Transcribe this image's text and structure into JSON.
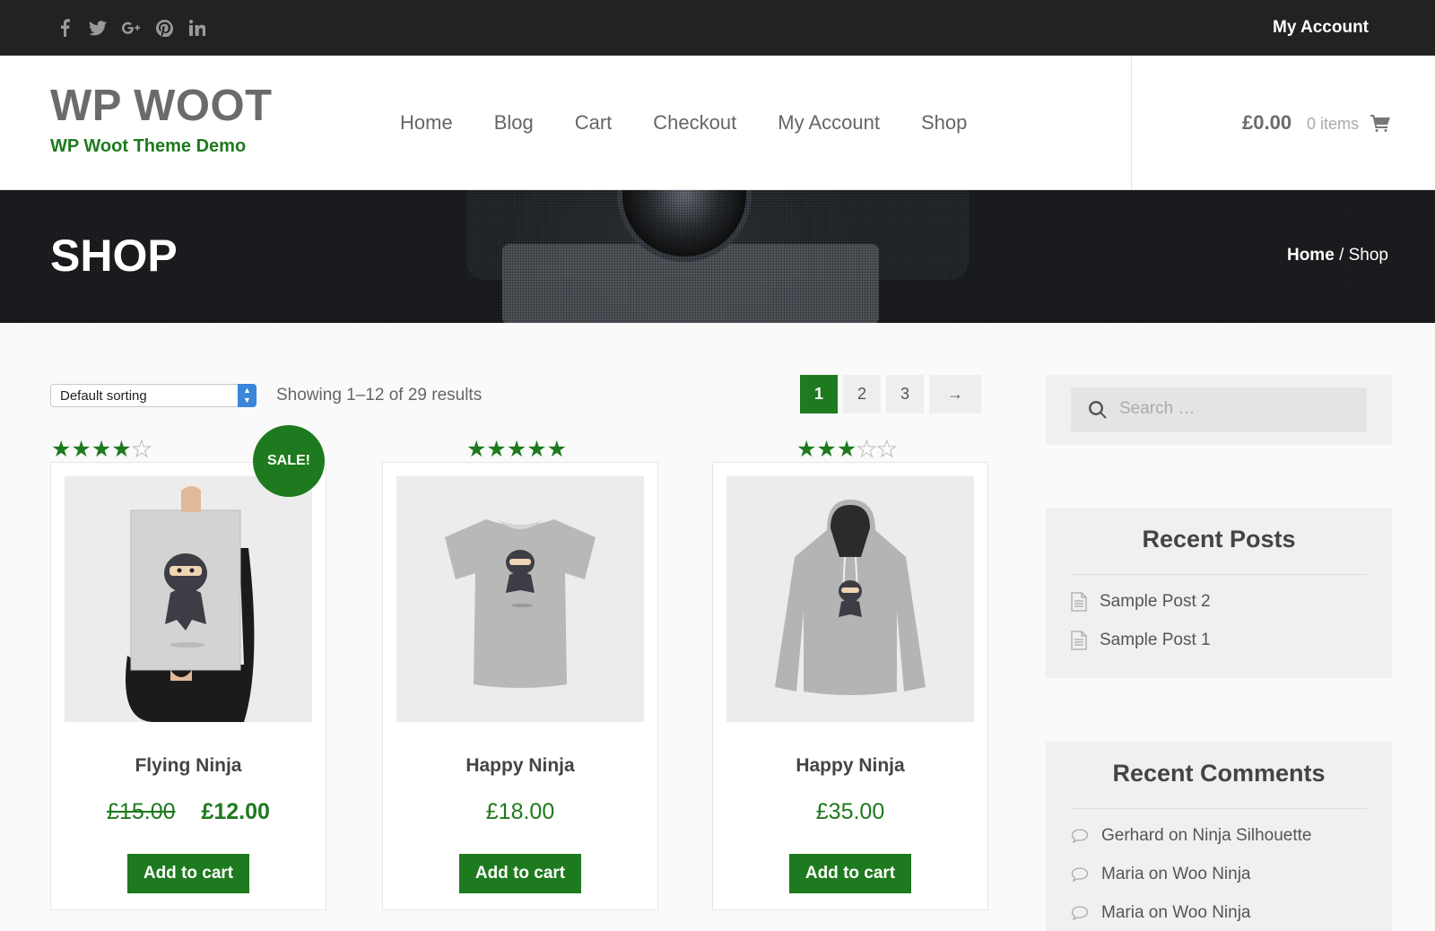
{
  "topbar": {
    "social": [
      "facebook-icon",
      "twitter-icon",
      "google-plus-icon",
      "pinterest-icon",
      "linkedin-icon"
    ],
    "account_label": "My Account"
  },
  "header": {
    "site_title": "WP WOOT",
    "tagline": "WP Woot Theme Demo",
    "nav": [
      "Home",
      "Blog",
      "Cart",
      "Checkout",
      "My Account",
      "Shop"
    ],
    "cart_total": "£0.00",
    "cart_count": "0 items"
  },
  "banner": {
    "title": "SHOP",
    "breadcrumb_home": "Home",
    "breadcrumb_sep": "/",
    "breadcrumb_current": "Shop"
  },
  "toolbar": {
    "sorting_value": "Default sorting",
    "result_count": "Showing 1–12 of 29 results",
    "pages": [
      "1",
      "2",
      "3"
    ],
    "next": "→",
    "current_page": 1
  },
  "products": [
    {
      "name": "Flying Ninja",
      "rating": 4,
      "old_price": "£15.00",
      "price": "£12.00",
      "sale": "SALE!",
      "button": "Add to cart"
    },
    {
      "name": "Happy Ninja",
      "rating": 5,
      "price": "£18.00",
      "button": "Add to cart"
    },
    {
      "name": "Happy Ninja",
      "rating": 3,
      "price": "£35.00",
      "button": "Add to cart"
    }
  ],
  "sidebar": {
    "search_placeholder": "Search …",
    "recent_posts_title": "Recent Posts",
    "recent_posts": [
      "Sample Post 2",
      "Sample Post 1"
    ],
    "recent_comments_title": "Recent Comments",
    "recent_comments": [
      "Gerhard on Ninja Silhouette",
      "Maria on Woo Ninja",
      "Maria on Woo Ninja"
    ]
  },
  "colors": {
    "accent": "#1e7a1e",
    "topbar": "#222222"
  }
}
